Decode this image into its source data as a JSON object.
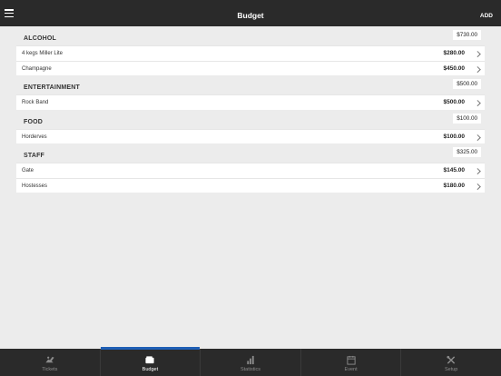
{
  "header": {
    "title": "Budget",
    "add_label": "ADD"
  },
  "sections": [
    {
      "title": "ALCOHOL",
      "total": "$730.00",
      "items": [
        {
          "label": "4 kegs Miller Lite",
          "amount": "$280.00"
        },
        {
          "label": "Champagne",
          "amount": "$450.00"
        }
      ]
    },
    {
      "title": "ENTERTAINMENT",
      "total": "$500.00",
      "items": [
        {
          "label": "Rock Band",
          "amount": "$500.00"
        }
      ]
    },
    {
      "title": "FOOD",
      "total": "$100.00",
      "items": [
        {
          "label": "Horderves",
          "amount": "$100.00"
        }
      ]
    },
    {
      "title": "STAFF",
      "total": "$325.00",
      "items": [
        {
          "label": "Gate",
          "amount": "$145.00"
        },
        {
          "label": "Hostesses",
          "amount": "$180.00"
        }
      ]
    }
  ],
  "tabs": [
    {
      "label": "Tickets",
      "icon": "tickets-icon"
    },
    {
      "label": "Budget",
      "icon": "wallet-icon",
      "active": true
    },
    {
      "label": "Statistics",
      "icon": "bar-chart-icon"
    },
    {
      "label": "Event",
      "icon": "calendar-icon"
    },
    {
      "label": "Setup",
      "icon": "tools-icon"
    }
  ],
  "colors": {
    "bar": "#2a2a2a",
    "accent": "#1f5fb5",
    "background": "#ececec"
  }
}
